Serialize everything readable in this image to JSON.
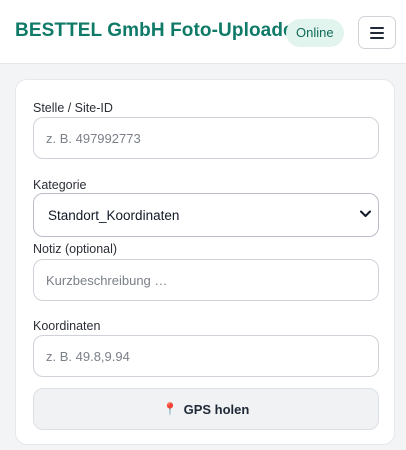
{
  "header": {
    "title": "BESTTEL GmbH Foto-Uploader",
    "status": "Online",
    "menu_icon": "hamburger-menu-icon"
  },
  "form": {
    "site": {
      "label": "Stelle / Site-ID",
      "placeholder": "z. B. 497992773",
      "value": ""
    },
    "category": {
      "label": "Kategorie",
      "value": "Standort_Koordinaten"
    },
    "note": {
      "label": "Notiz (optional)",
      "placeholder": "Kurzbeschreibung …",
      "value": ""
    },
    "coords": {
      "label": "Koordinaten",
      "placeholder": "z. B. 49.8,9.94",
      "value": ""
    },
    "gps_button": {
      "label": "GPS holen",
      "icon": "pushpin-icon",
      "icon_glyph": "📍"
    }
  },
  "colors": {
    "brand": "#0f7a67",
    "badge_bg": "#e2f4ee",
    "page_bg": "#f3f4f6"
  }
}
